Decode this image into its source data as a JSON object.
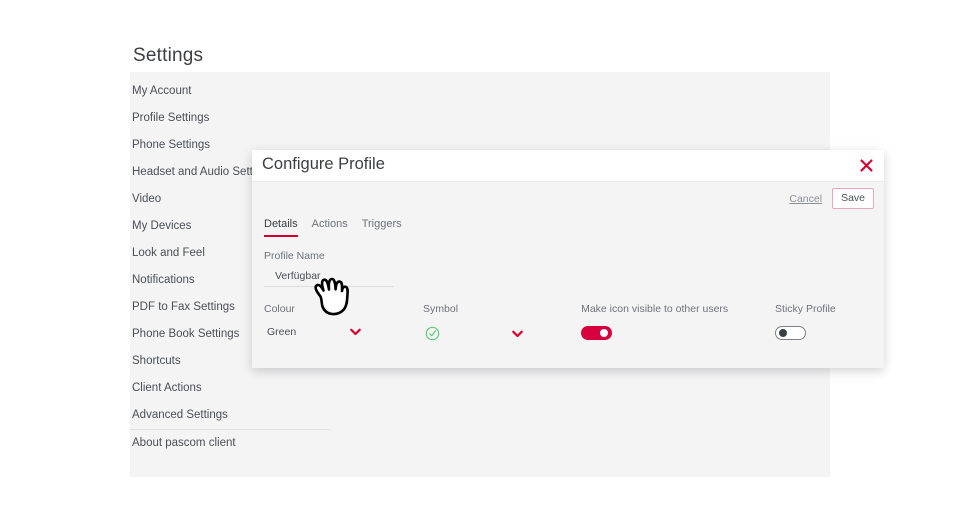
{
  "page": {
    "title": "Settings",
    "nav_items": [
      {
        "label": "My Account"
      },
      {
        "label": "Profile Settings"
      },
      {
        "label": "Phone Settings"
      },
      {
        "label": "Headset and Audio Settings"
      },
      {
        "label": "Video"
      },
      {
        "label": "My Devices"
      },
      {
        "label": "Look and Feel"
      },
      {
        "label": "Notifications"
      },
      {
        "label": "PDF to Fax Settings"
      },
      {
        "label": "Phone Book Settings"
      },
      {
        "label": "Shortcuts"
      },
      {
        "label": "Client Actions"
      },
      {
        "label": "Advanced Settings"
      },
      {
        "label": "About pascom client"
      }
    ]
  },
  "dialog": {
    "title": "Configure Profile",
    "close_icon": "close-icon",
    "cancel_label": "Cancel",
    "save_label": "Save",
    "tabs": [
      {
        "label": "Details",
        "active": true
      },
      {
        "label": "Actions",
        "active": false
      },
      {
        "label": "Triggers",
        "active": false
      }
    ],
    "profile_name": {
      "label": "Profile Name",
      "value": "Verfügbar",
      "placeholder": "Profile Name"
    },
    "colour": {
      "label": "Colour",
      "value": "Green",
      "dropdown_icon": "chevron-down-icon"
    },
    "symbol": {
      "label": "Symbol",
      "value_icon": "check-circle-icon",
      "dropdown_icon": "chevron-down-icon"
    },
    "visible_to_others": {
      "label": "Make icon visible to other users",
      "state": "on"
    },
    "sticky_profile": {
      "label": "Sticky Profile",
      "state": "off"
    }
  },
  "cursor": {
    "icon": "hand-pointer-cursor"
  },
  "colors": {
    "accent_red": "#d6002f",
    "toggle_on": "#d6003c",
    "symbol_green": "#5ec97a",
    "panel_bg": "#f4f4f5",
    "text": "#4a4f55"
  }
}
